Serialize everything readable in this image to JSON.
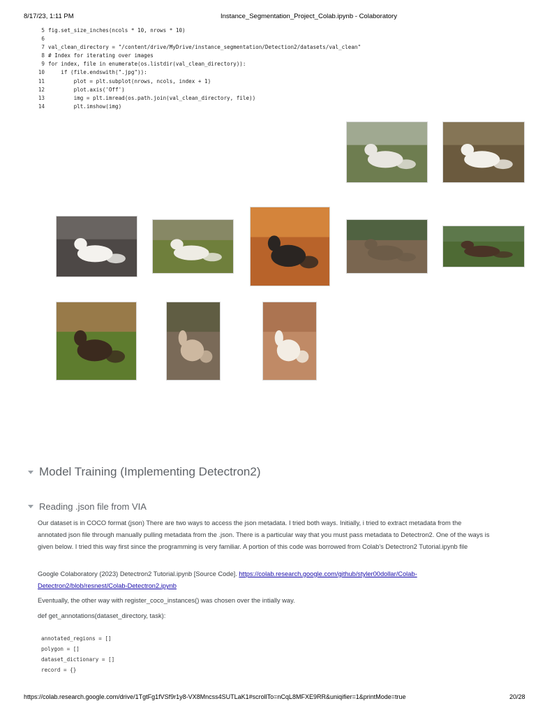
{
  "header": {
    "datetime": "8/17/23, 1:11 PM",
    "title": "Instance_Segmentation_Project_Colab.ipynb - Colaboratory"
  },
  "code_cell": {
    "lines": [
      {
        "n": "5",
        "t": "fig.set_size_inches(ncols * 10, nrows * 10)"
      },
      {
        "n": "6",
        "t": ""
      },
      {
        "n": "7",
        "t": "val_clean_directory = \"/content/drive/MyDrive/instance_segmentation/Detection2/datasets/val_clean\""
      },
      {
        "n": "8",
        "t": "# Index for iterating over images"
      },
      {
        "n": "9",
        "t": "for index, file in enumerate(os.listdir(val_clean_directory)):"
      },
      {
        "n": "10",
        "t": "    if (file.endswith(\".jpg\")):"
      },
      {
        "n": "11",
        "t": "        plot = plt.subplot(nrows, ncols, index + 1)"
      },
      {
        "n": "12",
        "t": "        plot.axis('Off')"
      },
      {
        "n": "13",
        "t": "        img = plt.imread(os.path.join(val_clean_directory, file))"
      },
      {
        "n": "14",
        "t": "        plt.imshow(img)"
      }
    ]
  },
  "images": [
    {
      "name": "goat-image-fence",
      "bg": "#6e7d50",
      "accent": "#e8e6e0",
      "sky": "#a9b09c"
    },
    {
      "name": "goat-image-white-rocks",
      "bg": "#6b5a3e",
      "accent": "#f2f0ea",
      "sky": "#8a7a5a"
    },
    {
      "name": "goat-image-white-horns",
      "bg": "#4d4846",
      "accent": "#f4f2ee",
      "sky": "#6f6a66"
    },
    {
      "name": "goat-image-two-white",
      "bg": "#6f7f3c",
      "accent": "#eeece4",
      "sky": "#8c8a6c"
    },
    {
      "name": "goat-image-barn",
      "bg": "#b8632a",
      "accent": "#2a2522",
      "sky": "#d88a3e"
    },
    {
      "name": "goat-image-ibex-rock",
      "bg": "#7a6650",
      "accent": "#6d5c48",
      "sky": "#49623e"
    },
    {
      "name": "goat-image-ibex-field",
      "bg": "#4e6a34",
      "accent": "#4a3326",
      "sky": "#607a50"
    },
    {
      "name": "goat-image-two-brown",
      "bg": "#5e7c2e",
      "accent": "#3b2a1e",
      "sky": "#a27a4e"
    },
    {
      "name": "goat-image-mountain-slope",
      "bg": "#7a6a58",
      "accent": "#cdb8a0",
      "sky": "#5c5a40"
    },
    {
      "name": "goat-image-cliff",
      "bg": "#c08a66",
      "accent": "#f3ede4",
      "sky": "#a8704e"
    }
  ],
  "sections": {
    "model_training": "Model Training (Implementing Detectron2)",
    "reading_json": "Reading .json file from VIA"
  },
  "text": {
    "p1": "Our dataset is in COCO format (json) There are two ways to access the json metadata. I tried both ways. Initially, i tried to extract metadata from the annotated json file through manually pulling metadata from the .json. There is a particular way that you must pass metadata to Detectron2. One of the ways is given below. I tried this way first since the programming is very familiar. A portion of this code was borrowed from Colab's Detectron2 Tutorial.ipynb file",
    "p2_prefix": "Google Colaboratory (2023) Detectron2 Tutorial.ipynb [Source Code]. ",
    "p2_link": "https://colab.research.google.com/github/styler00dollar/Colab-Detectron2/blob/resnest/Colab-Detectron2.ipynb",
    "p3": "Eventually, the other way with register_coco_instances() was chosen over the intially way.",
    "p4": "def get_annotations(dataset_directory, task):"
  },
  "code_cell2": {
    "lines": [
      "annotated_regions = []",
      "polygon = []",
      "dataset_dictionary = []",
      "record = {}"
    ]
  },
  "footer": {
    "url": "https://colab.research.google.com/drive/1TgtFg1fVSf9r1y8-VX8Mncss4SUTLaK1#scrollTo=nCqL8MFXE9RR&uniqifier=1&printMode=true",
    "page": "20/28"
  }
}
